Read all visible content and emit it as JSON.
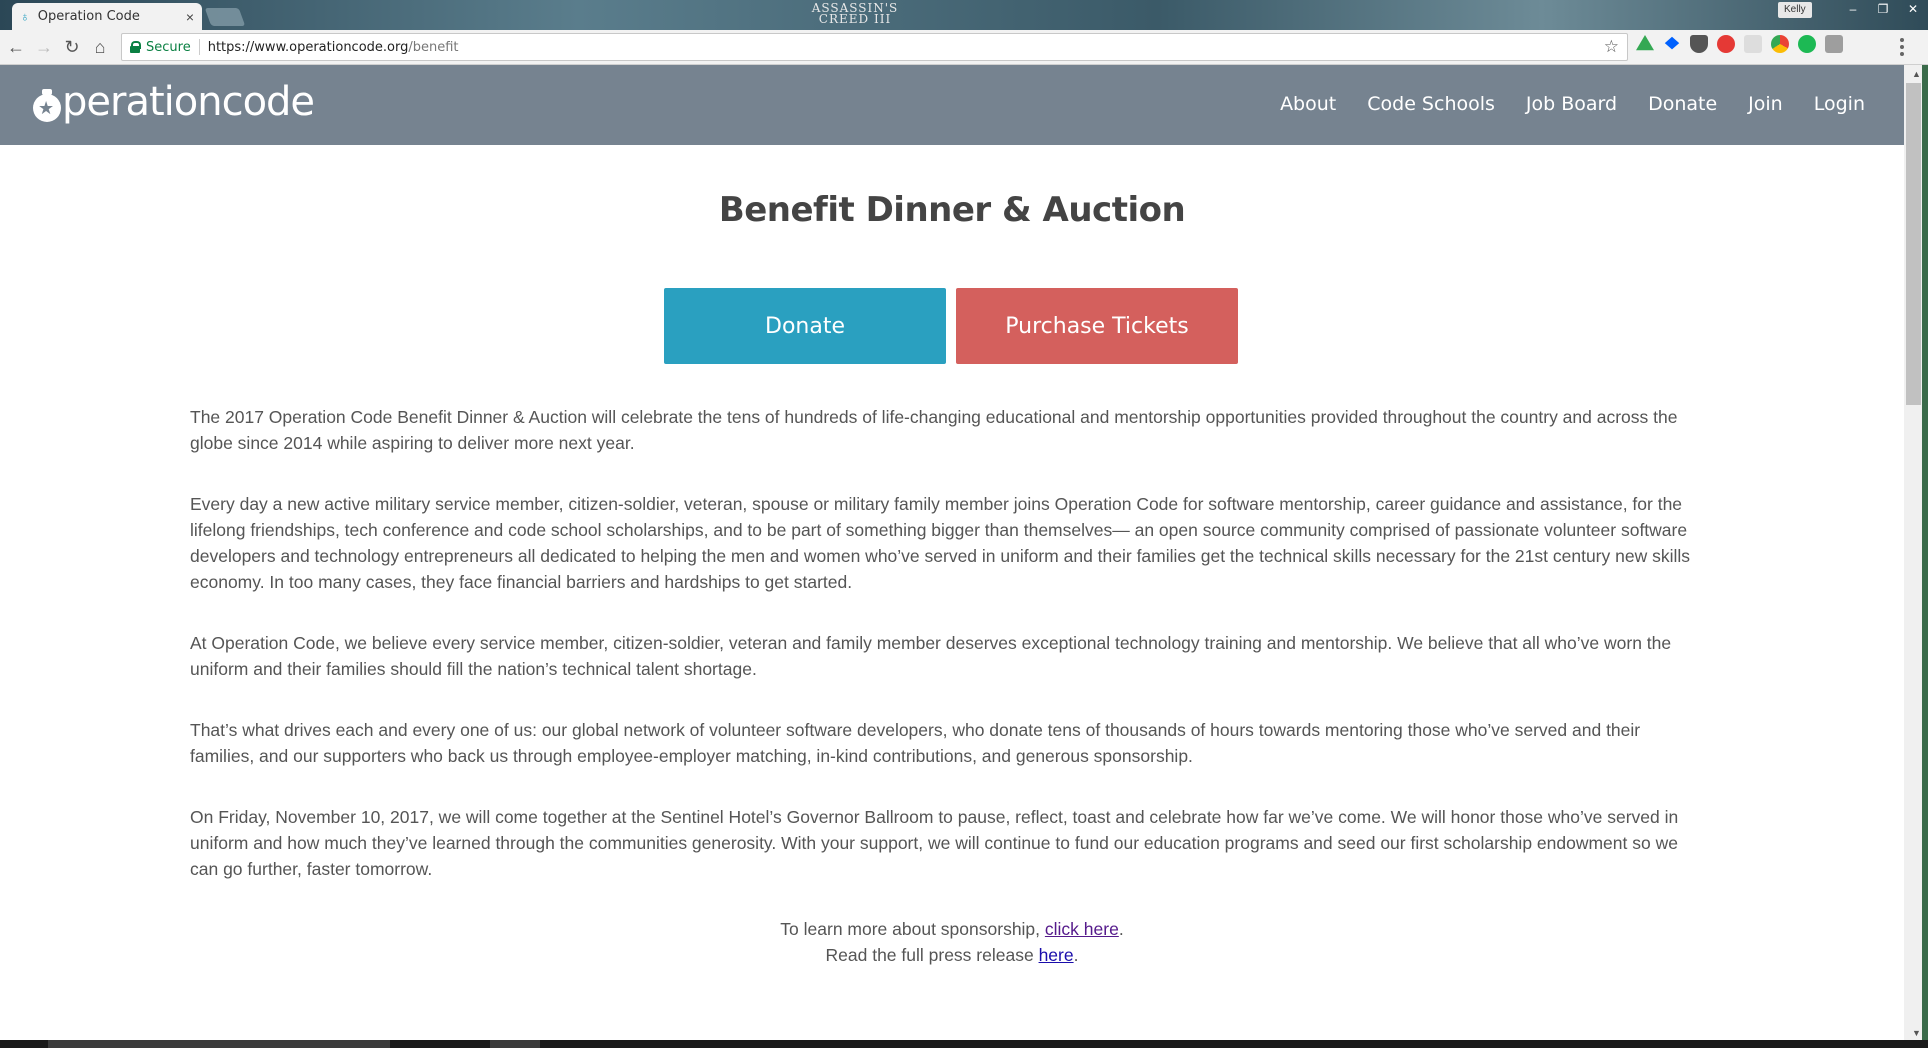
{
  "browser": {
    "tab_title": "Operation Code",
    "tab_close": "×",
    "titlebar_logo": "ASSASSIN'S CREED III",
    "user": "Kelly",
    "window_buttons": [
      "–",
      "❐",
      "✕"
    ],
    "nav_icons": [
      "back-icon",
      "forward-icon",
      "reload-icon",
      "home-icon"
    ],
    "secure_label": "Secure",
    "url_host": "https://www.operationcode.org",
    "url_path": "/benefit",
    "extensions": [
      {
        "name": "google-drive-icon",
        "color": "#34a853"
      },
      {
        "name": "dropbox-icon",
        "color": "#0061fe"
      },
      {
        "name": "shield-extension-icon",
        "color": "#555555"
      },
      {
        "name": "adblock-icon",
        "color": "#e53935"
      },
      {
        "name": "extension-icon",
        "color": "#dddddd"
      },
      {
        "name": "chrome-extension-icon",
        "color": "#fbbc05"
      },
      {
        "name": "checkmark-extension-icon",
        "color": "#1db954"
      },
      {
        "name": "puzzle-extension-icon",
        "color": "#9e9e9e"
      }
    ]
  },
  "site": {
    "logo_text": "peration code",
    "logo_text_display": "perationcode",
    "nav": [
      "About",
      "Code Schools",
      "Job Board",
      "Donate",
      "Join",
      "Login"
    ],
    "header_color": "#768390"
  },
  "page": {
    "title": "Benefit Dinner & Auction",
    "donate_button": "Donate",
    "tickets_button": "Purchase Tickets",
    "donate_color": "#2aa0c0",
    "tickets_color": "#d4605d",
    "paragraphs": [
      "The 2017 Operation Code Benefit Dinner & Auction will celebrate the tens of hundreds of life-changing educational and mentorship opportunities provided throughout the country and across the globe since 2014 while aspiring to deliver more next year.",
      "Every day a new active military service member, citizen-soldier, veteran, spouse or military family member joins Operation Code for software mentorship, career guidance and assistance, for the lifelong friendships, tech conference and code school scholarships, and to be part of something bigger than themselves— an open source community comprised of passionate volunteer software developers and technology entrepreneurs all dedicated to helping the men and women who’ve served in uniform and their families get the technical skills necessary for the 21st century new skills economy. In too many cases, they face financial barriers and hardships to get started.",
      "At Operation Code, we believe every service member, citizen-soldier, veteran and family member deserves exceptional technology training and mentorship. We believe that all who’ve worn the uniform and their families should fill the nation’s technical talent shortage.",
      "That’s what drives each and every one of us: our global network of volunteer software developers, who donate tens of thousands of hours towards mentoring those who’ve served and their families, and our supporters who back us through employee-employer matching, in-kind contributions, and generous sponsorship.",
      "On Friday, November 10, 2017, we will come together at the Sentinel Hotel’s Governor Ballroom to pause, reflect, toast and celebrate how far we’ve come. We will honor those who’ve served in uniform and how much they’ve learned through the communities generosity. With your support, we will continue to fund our education programs and seed our first scholarship endowment so we can go further, faster tomorrow."
    ],
    "sponsorship_prefix": "To learn more about sponsorship, ",
    "sponsorship_link": "click here",
    "sponsorship_suffix": ".",
    "press_prefix": "Read the full press release ",
    "press_link": "here",
    "press_suffix": "."
  }
}
